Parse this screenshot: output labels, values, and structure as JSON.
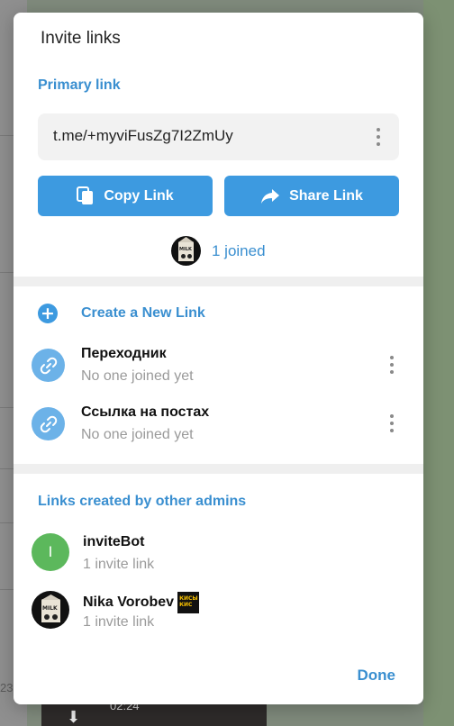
{
  "background": {
    "timestamp": "02:24",
    "partial_number": "23"
  },
  "dialog": {
    "title": "Invite links",
    "primary_link": {
      "section_title": "Primary link",
      "url": "t.me/+myviFusZg7I2ZmUy",
      "copy_label": "Copy Link",
      "share_label": "Share Link",
      "joined_text": "1 joined"
    },
    "create_label": "Create a New Link",
    "links": [
      {
        "name": "Переходник",
        "status": "No one joined yet"
      },
      {
        "name": "Ссылка на постах",
        "status": "No one joined yet"
      }
    ],
    "other_admins": {
      "section_title": "Links created by other admins",
      "admins": [
        {
          "name": "inviteBot",
          "initial": "I",
          "subtitle": "1 invite link"
        },
        {
          "name": "Nika Vorobev",
          "subtitle": "1 invite link",
          "badge_text": "КИСЫ\nКИС"
        }
      ]
    },
    "done_label": "Done"
  },
  "colors": {
    "accent": "#3a8fd0",
    "button": "#3d9ae0",
    "link_icon": "#6cb2e8",
    "admin_green": "#5cb85c"
  },
  "icons": {
    "copy": "copy-icon",
    "share": "share-arrow-icon",
    "kebab": "more-vertical-icon",
    "plus": "plus-circle-icon",
    "link": "link-icon"
  }
}
